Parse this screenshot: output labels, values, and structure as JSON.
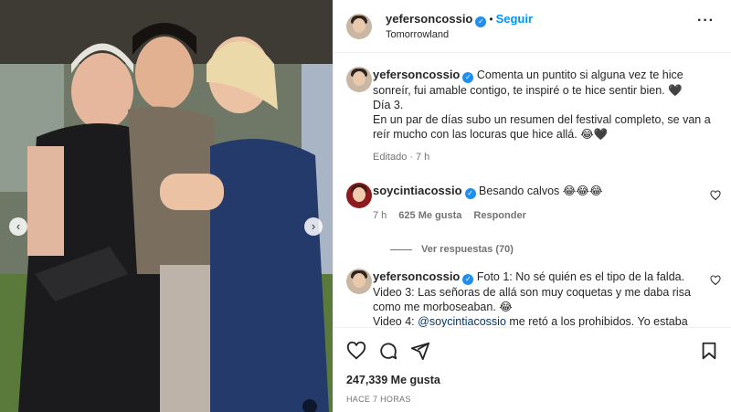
{
  "header": {
    "username": "yefersoncossio",
    "follow_label": "Seguir",
    "location": "Tomorrowland",
    "more_icon": "more-horizontal-icon"
  },
  "caption": {
    "username": "yefersoncossio",
    "lines": [
      "Comenta un puntito si alguna vez te hice sonreír, fui amable contigo, te inspiré o te hice sentir bien. 🖤",
      "Día 3.",
      "En un par de días subo un resumen del festival completo, se van a reír mucho con las locuras que hice allá. 😂🖤"
    ],
    "edited": "Editado",
    "time": "7 h"
  },
  "comments": [
    {
      "username": "soycintiacossio",
      "text": "Besando calvos 😂😂😂",
      "time": "7 h",
      "likes": "625 Me gusta",
      "reply_label": "Responder",
      "view_replies": "Ver respuestas (70)"
    },
    {
      "username": "yefersoncossio",
      "lines": [
        "Foto 1: No sé quién es el tipo de la falda.",
        "Video 3: Las señoras de allá son muy coquetas y me daba risa como me morboseaban. 😂",
        "Video 4:"
      ],
      "mention": "@soycintiacossio",
      "line_tail": "me retó a los prohibidos. Yo estaba"
    }
  ],
  "actions": {
    "likes": "247,339 Me gusta",
    "time_ago": "HACE 7 HORAS"
  },
  "colors": {
    "accent": "#0095f6",
    "verified": "#1f8ef1",
    "secondary_text": "#737373",
    "divider": "#efefef"
  }
}
